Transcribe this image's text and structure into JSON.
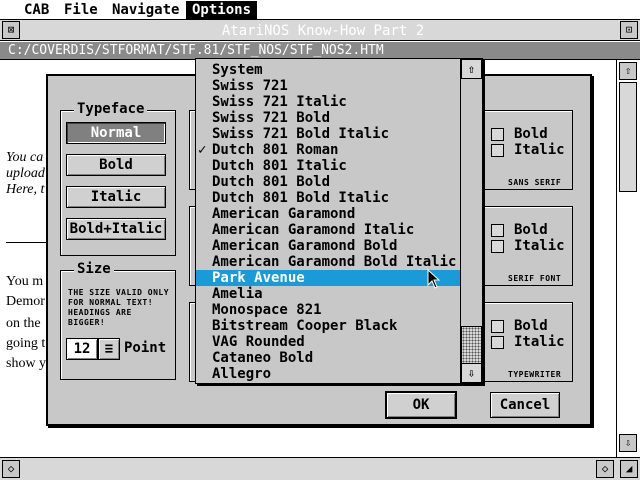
{
  "menubar": {
    "items": [
      "CAB",
      "File",
      "Navigate",
      "Options"
    ]
  },
  "window": {
    "title": "AtariNOS Know-How Part 2",
    "path": "C:/COVERDIS/STFORMAT/STF.81/STF_NOS/STF_NOS2.HTM"
  },
  "document": {
    "lines_italic": [
      "You ca",
      "upload",
      "Here, t"
    ],
    "lines_normal": [
      "You m",
      "Demor",
      "on the",
      "going t",
      "show y"
    ]
  },
  "dialog": {
    "typeface": {
      "title": "Typeface",
      "buttons": [
        "Normal",
        "Bold",
        "Italic",
        "Bold+Italic"
      ]
    },
    "size": {
      "title": "Size",
      "note": "THE SIZE VALID ONLY FOR NORMAL TEXT! HEADINGS ARE BIGGER!",
      "value": "12",
      "unit": "Point"
    },
    "styles": [
      {
        "bold": "Bold",
        "italic": "Italic",
        "caption": "SANS SERIF"
      },
      {
        "bold": "Bold",
        "italic": "Italic",
        "caption": "SERIF FONT"
      },
      {
        "bold": "Bold",
        "italic": "Italic",
        "caption": "TYPEWRITER"
      }
    ],
    "ok_label": "OK",
    "cancel_label": "Cancel"
  },
  "font_list": {
    "items": [
      "System",
      "Swiss 721",
      "Swiss 721 Italic",
      "Swiss 721 Bold",
      "Swiss 721 Bold Italic",
      "Dutch 801 Roman",
      "Dutch 801 Italic",
      "Dutch 801 Bold",
      "Dutch 801 Bold Italic",
      "American Garamond",
      "American Garamond Italic",
      "American Garamond Bold",
      "American Garamond Bold Italic",
      "Park Avenue",
      "Amelia",
      "Monospace 821",
      "Bitstream Cooper Black",
      "VAG Rounded",
      "Cataneo Bold",
      "Allegro"
    ],
    "checked": "Dutch 801 Roman",
    "highlighted": "Park Avenue",
    "check_glyph": "✓"
  },
  "icons": {
    "scroll_up": "up-arrow-icon",
    "scroll_down": "down-arrow-icon",
    "close": "close-icon",
    "fuller": "fuller-icon"
  },
  "colors": {
    "highlight": "#1a9ad6",
    "dialog_bg": "#c8c8c8"
  }
}
